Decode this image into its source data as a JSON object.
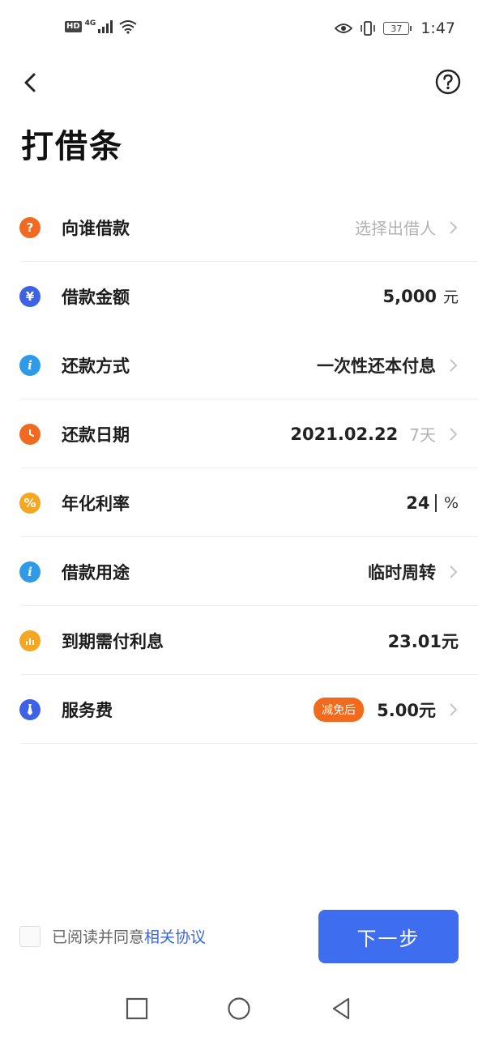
{
  "status_bar": {
    "hd": "HD",
    "network": "4G",
    "battery": "37",
    "time": "1:47"
  },
  "page": {
    "title": "打借条"
  },
  "rows": [
    {
      "label": "向谁借款",
      "value": "选择出借人",
      "icon_color": "#f06a22",
      "icon_glyph": "?"
    },
    {
      "label": "借款金额",
      "value": "5,000",
      "unit": "元",
      "icon_color": "#3d62e6",
      "icon_glyph": "¥"
    },
    {
      "label": "还款方式",
      "value": "一次性还本付息",
      "icon_color": "#2f9be8",
      "icon_glyph": "i"
    },
    {
      "label": "还款日期",
      "value": "2021.02.22",
      "extra": "7天",
      "icon_color": "#f06a22",
      "icon_glyph": "clock"
    },
    {
      "label": "年化利率",
      "value": "24",
      "unit": "%",
      "icon_color": "#f5a623",
      "icon_glyph": "%"
    },
    {
      "label": "借款用途",
      "value": "临时周转",
      "icon_color": "#2f9be8",
      "icon_glyph": "i"
    },
    {
      "label": "到期需付利息",
      "value": "23.01元",
      "icon_color": "#f5a623",
      "icon_glyph": "bars"
    },
    {
      "label": "服务费",
      "tag": "减免后",
      "value": "5.00元",
      "icon_color": "#3d62e6",
      "icon_glyph": "tie"
    }
  ],
  "bottom": {
    "agree_text": "已阅读并同意",
    "agree_link": "相关协议",
    "next_button": "下一步"
  },
  "colors": {
    "primary": "#3f6df0",
    "orange": "#f06a22",
    "yellow": "#f5a623",
    "blue": "#2f9be8",
    "link": "#3a66e0"
  }
}
